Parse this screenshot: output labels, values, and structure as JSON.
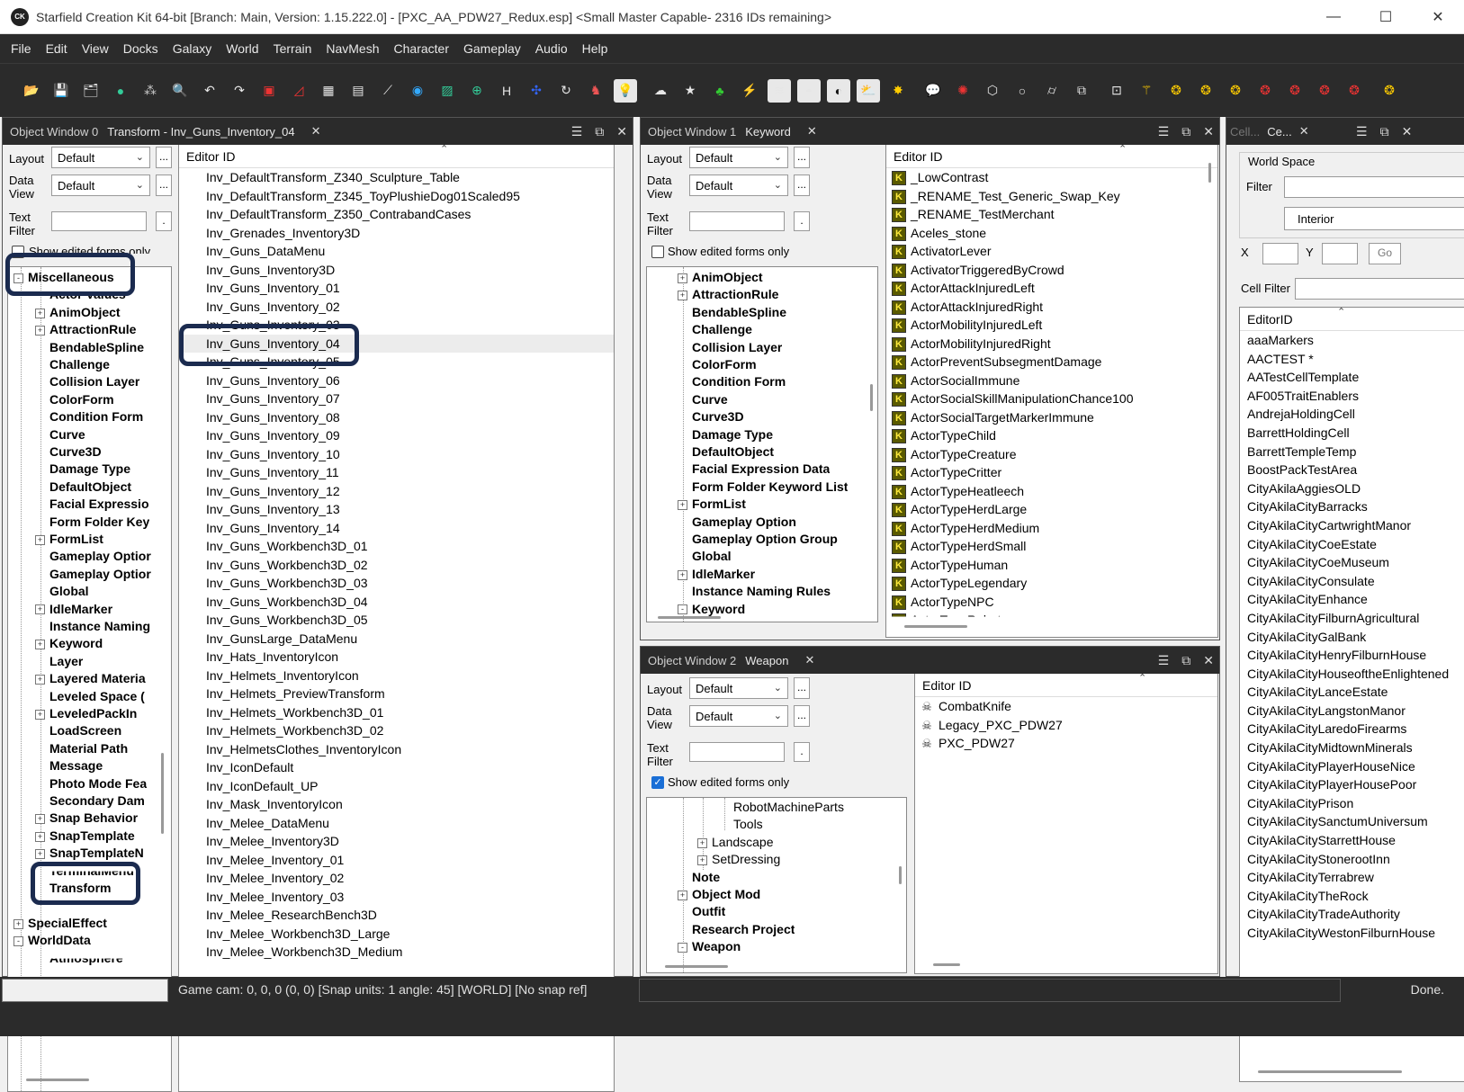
{
  "window": {
    "title": "Starfield Creation Kit 64-bit [Branch: Main, Version: 1.15.222.0] - [PXC_AA_PDW27_Redux.esp] <Small Master Capable- 2316 IDs remaining>",
    "app_badge": "CK",
    "minimize": "—",
    "maximize": "☐",
    "close": "✕"
  },
  "menu": [
    "File",
    "Edit",
    "View",
    "Docks",
    "Galaxy",
    "World",
    "Terrain",
    "NavMesh",
    "Character",
    "Gameplay",
    "Audio",
    "Help"
  ],
  "toolbar_icons": [
    {
      "name": "open-icon",
      "glyph": "📂"
    },
    {
      "name": "save-icon",
      "glyph": "💾"
    },
    {
      "name": "preferences-icon",
      "glyph": "🗂"
    },
    {
      "name": "color-dots-icon",
      "glyph": "●"
    },
    {
      "name": "scatter-icon",
      "glyph": "⁂"
    },
    {
      "name": "find-icon",
      "glyph": "🔍"
    },
    {
      "name": "undo-icon",
      "glyph": "↶"
    },
    {
      "name": "redo-icon",
      "glyph": "↷"
    },
    {
      "name": "bounds-icon",
      "glyph": "▣"
    },
    {
      "name": "angle-icon",
      "glyph": "◿"
    },
    {
      "name": "grid-icon",
      "glyph": "▦"
    },
    {
      "name": "layers-icon",
      "glyph": "▤"
    },
    {
      "name": "snap-icon",
      "glyph": "⟋"
    },
    {
      "name": "globe-icon",
      "glyph": "◉"
    },
    {
      "name": "landscape-icon",
      "glyph": "▨"
    },
    {
      "name": "navmesh-icon",
      "glyph": "⊕"
    },
    {
      "name": "text-icon",
      "glyph": "H"
    },
    {
      "name": "network-icon",
      "glyph": "✣"
    },
    {
      "name": "rotate-icon",
      "glyph": "↻"
    },
    {
      "name": "creature-icon",
      "glyph": "♞"
    },
    {
      "name": "light-bulb-icon",
      "glyph": "💡"
    },
    {
      "name": "sky-icon",
      "glyph": "☁"
    },
    {
      "name": "star-icon",
      "glyph": "★"
    },
    {
      "name": "grass-icon",
      "glyph": "♣"
    },
    {
      "name": "lightning-icon",
      "glyph": "⚡"
    },
    {
      "name": "wind-icon",
      "glyph": "≋"
    },
    {
      "name": "dome-icon",
      "glyph": "◓"
    },
    {
      "name": "contrast-icon",
      "glyph": "◐"
    },
    {
      "name": "cloud-icon",
      "glyph": "⛅"
    },
    {
      "name": "sun-icon",
      "glyph": "✸"
    },
    {
      "name": "chat-icon",
      "glyph": "💬"
    },
    {
      "name": "bug-icon",
      "glyph": "✺"
    },
    {
      "name": "cube-icon",
      "glyph": "⬡"
    },
    {
      "name": "sphere-icon",
      "glyph": "○"
    },
    {
      "name": "cylinder-icon",
      "glyph": "⌭"
    },
    {
      "name": "box-icon",
      "glyph": "⧉"
    },
    {
      "name": "frame-icon",
      "glyph": "⊡"
    },
    {
      "name": "wand-icon",
      "glyph": "⚚"
    },
    {
      "name": "badge-a-icon",
      "glyph": "❂"
    },
    {
      "name": "badge-b-icon",
      "glyph": "❂"
    },
    {
      "name": "badge-c-icon",
      "glyph": "❂"
    },
    {
      "name": "badge-d-icon",
      "glyph": "❂"
    },
    {
      "name": "badge-e-icon",
      "glyph": "❂"
    },
    {
      "name": "badge-f-icon",
      "glyph": "❂"
    },
    {
      "name": "badge-g-icon",
      "glyph": "❂"
    },
    {
      "name": "badge-h-icon",
      "glyph": "❂"
    }
  ],
  "ow0": {
    "tab0": "Object Window 0",
    "tab1": "Transform - Inv_Guns_Inventory_04",
    "layout_label": "Layout",
    "layout_value": "Default",
    "dataview_label": "Data View",
    "dataview_value": "Default",
    "textfilter_label": "Text Filter",
    "show_edited": "Show edited forms only",
    "tree": [
      {
        "t": "Miscellaneous",
        "lvl": 0,
        "pm": "-"
      },
      {
        "t": "Actor Values",
        "lvl": 1,
        "pm": ""
      },
      {
        "t": "AnimObject",
        "lvl": 1,
        "pm": "+"
      },
      {
        "t": "AttractionRule",
        "lvl": 1,
        "pm": "+"
      },
      {
        "t": "BendableSpline",
        "lvl": 1,
        "pm": ""
      },
      {
        "t": "Challenge",
        "lvl": 1,
        "pm": ""
      },
      {
        "t": "Collision Layer",
        "lvl": 1,
        "pm": ""
      },
      {
        "t": "ColorForm",
        "lvl": 1,
        "pm": ""
      },
      {
        "t": "Condition Form",
        "lvl": 1,
        "pm": ""
      },
      {
        "t": "Curve",
        "lvl": 1,
        "pm": ""
      },
      {
        "t": "Curve3D",
        "lvl": 1,
        "pm": ""
      },
      {
        "t": "Damage Type",
        "lvl": 1,
        "pm": ""
      },
      {
        "t": "DefaultObject",
        "lvl": 1,
        "pm": ""
      },
      {
        "t": "Facial Expressio",
        "lvl": 1,
        "pm": ""
      },
      {
        "t": "Form Folder Key",
        "lvl": 1,
        "pm": ""
      },
      {
        "t": "FormList",
        "lvl": 1,
        "pm": "+"
      },
      {
        "t": "Gameplay Optior",
        "lvl": 1,
        "pm": ""
      },
      {
        "t": "Gameplay Optior",
        "lvl": 1,
        "pm": ""
      },
      {
        "t": "Global",
        "lvl": 1,
        "pm": ""
      },
      {
        "t": "IdleMarker",
        "lvl": 1,
        "pm": "+"
      },
      {
        "t": "Instance Naming",
        "lvl": 1,
        "pm": ""
      },
      {
        "t": "Keyword",
        "lvl": 1,
        "pm": "+"
      },
      {
        "t": "Layer",
        "lvl": 1,
        "pm": ""
      },
      {
        "t": "Layered Materia",
        "lvl": 1,
        "pm": "+"
      },
      {
        "t": "Leveled Space (",
        "lvl": 1,
        "pm": ""
      },
      {
        "t": "LeveledPackIn",
        "lvl": 1,
        "pm": "+"
      },
      {
        "t": "LoadScreen",
        "lvl": 1,
        "pm": ""
      },
      {
        "t": "Material Path",
        "lvl": 1,
        "pm": ""
      },
      {
        "t": "Message",
        "lvl": 1,
        "pm": ""
      },
      {
        "t": "Photo Mode Fea",
        "lvl": 1,
        "pm": ""
      },
      {
        "t": "Secondary Dam",
        "lvl": 1,
        "pm": ""
      },
      {
        "t": "Snap Behavior",
        "lvl": 1,
        "pm": "+"
      },
      {
        "t": "SnapTemplate",
        "lvl": 1,
        "pm": "+"
      },
      {
        "t": "SnapTemplateN",
        "lvl": 1,
        "pm": "+"
      },
      {
        "t": "TerminalMenu",
        "lvl": 1,
        "pm": ""
      },
      {
        "t": "Transform",
        "lvl": 1,
        "pm": ""
      },
      {
        "t": "Transform",
        "lvl": 1,
        "pm": ""
      },
      {
        "t": "SpecialEffect",
        "lvl": 0,
        "pm": "+"
      },
      {
        "t": "WorldData",
        "lvl": 0,
        "pm": "-"
      },
      {
        "t": "Atmosphere",
        "lvl": 1,
        "pm": ""
      }
    ],
    "list_header": "Editor ID",
    "list": [
      "Inv_DefaultTransform_Z340_Sculpture_Table",
      "Inv_DefaultTransform_Z345_ToyPlushieDog01Scaled95",
      "Inv_DefaultTransform_Z350_ContrabandCases",
      "Inv_Grenades_Inventory3D",
      "Inv_Guns_DataMenu",
      "Inv_Guns_Inventory3D",
      "Inv_Guns_Inventory_01",
      "Inv_Guns_Inventory_02",
      "Inv_Guns_Inventory_03",
      "Inv_Guns_Inventory_04",
      "Inv_Guns_Inventory_05",
      "Inv_Guns_Inventory_06",
      "Inv_Guns_Inventory_07",
      "Inv_Guns_Inventory_08",
      "Inv_Guns_Inventory_09",
      "Inv_Guns_Inventory_10",
      "Inv_Guns_Inventory_11",
      "Inv_Guns_Inventory_12",
      "Inv_Guns_Inventory_13",
      "Inv_Guns_Inventory_14",
      "Inv_Guns_Workbench3D_01",
      "Inv_Guns_Workbench3D_02",
      "Inv_Guns_Workbench3D_03",
      "Inv_Guns_Workbench3D_04",
      "Inv_Guns_Workbench3D_05",
      "Inv_GunsLarge_DataMenu",
      "Inv_Hats_InventoryIcon",
      "Inv_Helmets_InventoryIcon",
      "Inv_Helmets_PreviewTransform",
      "Inv_Helmets_Workbench3D_01",
      "Inv_Helmets_Workbench3D_02",
      "Inv_HelmetsClothes_InventoryIcon",
      "Inv_IconDefault",
      "Inv_IconDefault_UP",
      "Inv_Mask_InventoryIcon",
      "Inv_Melee_DataMenu",
      "Inv_Melee_Inventory3D",
      "Inv_Melee_Inventory_01",
      "Inv_Melee_Inventory_02",
      "Inv_Melee_Inventory_03",
      "Inv_Melee_ResearchBench3D",
      "Inv_Melee_Workbench3D_Large",
      "Inv_Melee_Workbench3D_Medium"
    ]
  },
  "ow1": {
    "tab0": "Object Window 1",
    "tab1": "Keyword",
    "layout_label": "Layout",
    "layout_value": "Default",
    "dataview_label": "Data View",
    "dataview_value": "Default",
    "textfilter_label": "Text Filter",
    "show_edited": "Show edited forms only",
    "tree": [
      {
        "t": "AnimObject",
        "pm": "+"
      },
      {
        "t": "AttractionRule",
        "pm": "+"
      },
      {
        "t": "BendableSpline",
        "pm": ""
      },
      {
        "t": "Challenge",
        "pm": ""
      },
      {
        "t": "Collision Layer",
        "pm": ""
      },
      {
        "t": "ColorForm",
        "pm": ""
      },
      {
        "t": "Condition Form",
        "pm": ""
      },
      {
        "t": "Curve",
        "pm": ""
      },
      {
        "t": "Curve3D",
        "pm": ""
      },
      {
        "t": "Damage Type",
        "pm": ""
      },
      {
        "t": "DefaultObject",
        "pm": ""
      },
      {
        "t": "Facial Expression Data",
        "pm": ""
      },
      {
        "t": "Form Folder Keyword List",
        "pm": ""
      },
      {
        "t": "FormList",
        "pm": "+"
      },
      {
        "t": "Gameplay Option",
        "pm": ""
      },
      {
        "t": "Gameplay Option Group",
        "pm": ""
      },
      {
        "t": "Global",
        "pm": ""
      },
      {
        "t": "IdleMarker",
        "pm": "+"
      },
      {
        "t": "Instance Naming Rules",
        "pm": ""
      },
      {
        "t": "Keyword",
        "pm": "-"
      }
    ],
    "list_header": "Editor ID",
    "list": [
      "_LowContrast",
      "_RENAME_Test_Generic_Swap_Key",
      "_RENAME_TestMerchant",
      "Aceles_stone",
      "ActivatorLever",
      "ActivatorTriggeredByCrowd",
      "ActorAttackInjuredLeft",
      "ActorAttackInjuredRight",
      "ActorMobilityInjuredLeft",
      "ActorMobilityInjuredRight",
      "ActorPreventSubsegmentDamage",
      "ActorSocialImmune",
      "ActorSocialSkillManipulationChance100",
      "ActorSocialTargetMarkerImmune",
      "ActorTypeChild",
      "ActorTypeCreature",
      "ActorTypeCritter",
      "ActorTypeHeatleech",
      "ActorTypeHerdLarge",
      "ActorTypeHerdMedium",
      "ActorTypeHerdSmall",
      "ActorTypeHuman",
      "ActorTypeLegendary",
      "ActorTypeNPC",
      "ActorTypeRobot"
    ],
    "k_glyph": "K"
  },
  "ow2": {
    "tab0": "Object Window 2",
    "tab1": "Weapon",
    "layout_label": "Layout",
    "layout_value": "Default",
    "dataview_label": "Data View",
    "dataview_value": "Default",
    "textfilter_label": "Text Filter",
    "show_edited": "Show edited forms only",
    "check_mark": "✓",
    "tree": [
      {
        "t": "RobotMachineParts",
        "lvl": 3,
        "pm": "",
        "b": false
      },
      {
        "t": "Tools",
        "lvl": 3,
        "pm": "",
        "b": false
      },
      {
        "t": "Landscape",
        "lvl": 2,
        "pm": "+",
        "b": false
      },
      {
        "t": "SetDressing",
        "lvl": 2,
        "pm": "+",
        "b": false
      },
      {
        "t": "Note",
        "lvl": 1,
        "pm": "",
        "b": true
      },
      {
        "t": "Object Mod",
        "lvl": 1,
        "pm": "+",
        "b": true
      },
      {
        "t": "Outfit",
        "lvl": 1,
        "pm": "",
        "b": true
      },
      {
        "t": "Research Project",
        "lvl": 1,
        "pm": "",
        "b": true
      },
      {
        "t": "Weapon",
        "lvl": 1,
        "pm": "-",
        "b": true
      }
    ],
    "list_header": "Editor ID",
    "list": [
      "CombatKnife",
      "Legacy_PXC_PDW27",
      "PXC_PDW27"
    ],
    "w_glyph": "☠"
  },
  "cell": {
    "tab0": "Cell...",
    "tab1": "Ce...",
    "worldspace_label": "World Space",
    "filter_label": "Filter",
    "interior": "Interior",
    "x_label": "X",
    "y_label": "Y",
    "go": "Go",
    "cellfilter_label": "Cell Filter",
    "list_header": "EditorID",
    "list": [
      "aaaMarkers",
      "AACTEST *",
      "AATestCellTemplate",
      "AF005TraitEnablers",
      "AndrejaHoldingCell",
      "BarrettHoldingCell",
      "BarrettTempleTemp",
      "BoostPackTestArea",
      "CityAkilaAggiesOLD",
      "CityAkilaCityBarracks",
      "CityAkilaCityCartwrightManor",
      "CityAkilaCityCoeEstate",
      "CityAkilaCityCoeMuseum",
      "CityAkilaCityConsulate",
      "CityAkilaCityEnhance",
      "CityAkilaCityFilburnAgricultural",
      "CityAkilaCityGalBank",
      "CityAkilaCityHenryFilburnHouse",
      "CityAkilaCityHouseoftheEnlightened",
      "CityAkilaCityLanceEstate",
      "CityAkilaCityLangstonManor",
      "CityAkilaCityLaredoFirearms",
      "CityAkilaCityMidtownMinerals",
      "CityAkilaCityPlayerHouseNice",
      "CityAkilaCityPlayerHousePoor",
      "CityAkilaCityPrison",
      "CityAkilaCitySanctumUniversum",
      "CityAkilaCityStarrettHouse",
      "CityAkilaCityStonerootInn",
      "CityAkilaCityTerrabrew",
      "CityAkilaCityTheRock",
      "CityAkilaCityTradeAuthority",
      "CityAkilaCityWestonFilburnHouse"
    ]
  },
  "panel_icons": {
    "menu": "☰",
    "float": "⧉",
    "close": "✕",
    "combo_arrow": "⌄",
    "dots": "...",
    "dot": ".",
    "sort": "⌃"
  },
  "status": {
    "text": "Game cam: 0, 0, 0 (0, 0) [Snap units: 1 angle: 45] [WORLD] [No snap ref]",
    "done": "Done."
  },
  "colors": {
    "highlight": "#1b2b4f",
    "dark_chrome": "#2b2b2b",
    "check_blue": "#1a6fd6"
  }
}
